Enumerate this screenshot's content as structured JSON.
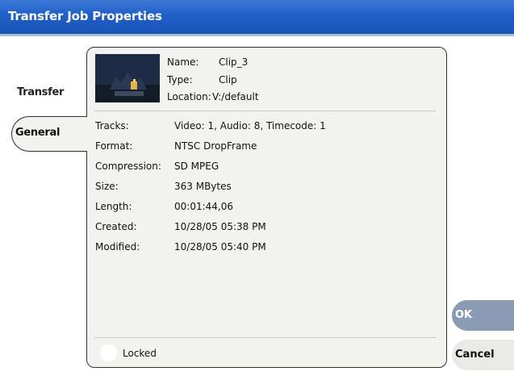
{
  "window": {
    "title": "Transfer Job Properties"
  },
  "tabs": [
    {
      "label": "Transfer"
    },
    {
      "label": "General"
    }
  ],
  "clip": {
    "name_label": "Name:",
    "name_value": "Clip_3",
    "type_label": "Type:",
    "type_value": "Clip",
    "location_label": "Location:",
    "location_value": "V:/default"
  },
  "properties": [
    {
      "label": "Tracks:",
      "value": "Video: 1, Audio: 8, Timecode: 1"
    },
    {
      "label": "Format:",
      "value": "NTSC DropFrame"
    },
    {
      "label": "Compression:",
      "value": "SD MPEG"
    },
    {
      "label": "Size:",
      "value": "363 MBytes"
    },
    {
      "label": "Length:",
      "value": "00:01:44,06"
    },
    {
      "label": "Created:",
      "value": "10/28/05 05:38 PM"
    },
    {
      "label": "Modified:",
      "value": "10/28/05 05:40 PM"
    }
  ],
  "locked": {
    "label": "Locked",
    "checked": false
  },
  "buttons": {
    "ok": "OK",
    "cancel": "Cancel"
  },
  "colors": {
    "titlebar": "#1f5fc7",
    "panel": "#f2f2ee",
    "ok_button": "#8a9bb3"
  }
}
